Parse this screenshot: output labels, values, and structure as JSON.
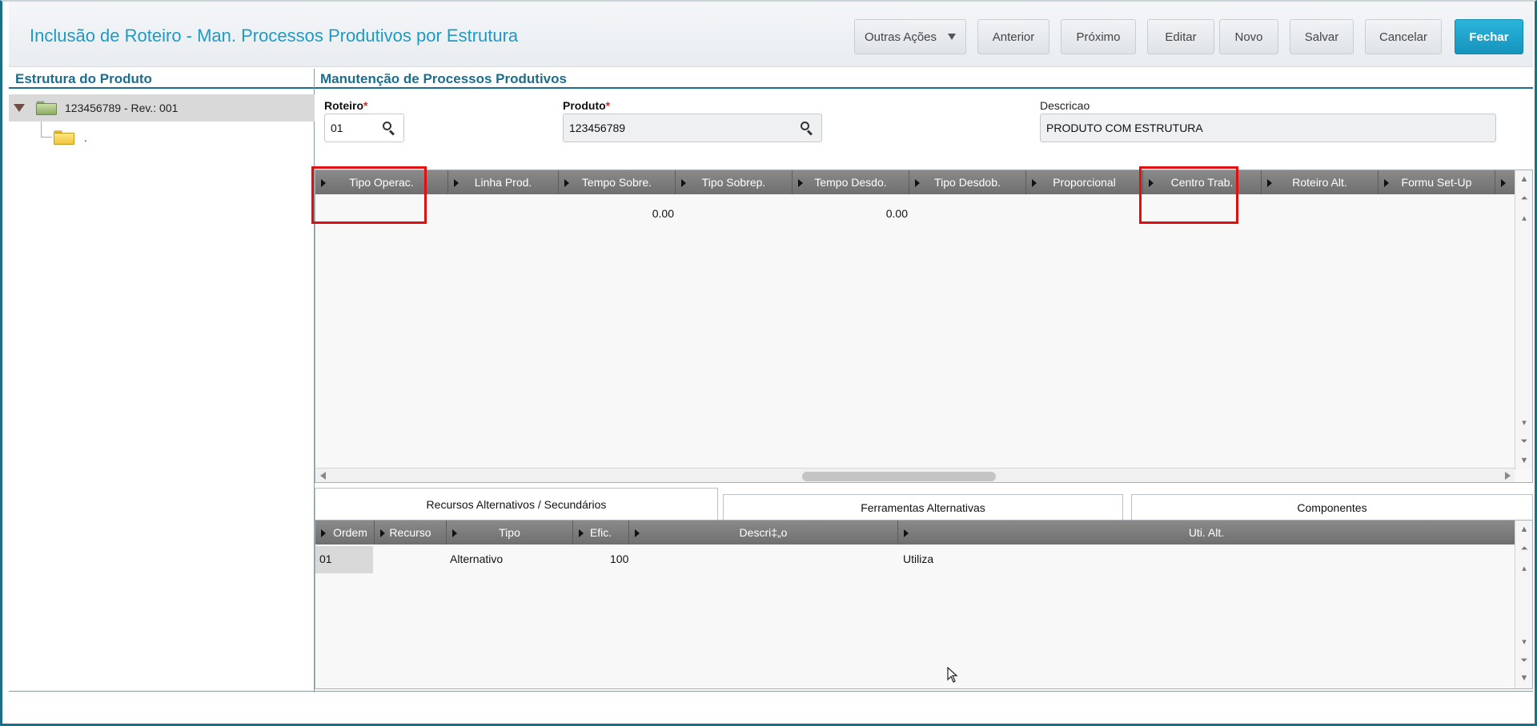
{
  "header": {
    "title": "Inclusão de Roteiro - Man. Processos Produtivos por Estrutura",
    "buttons": {
      "outras_acoes": "Outras Ações",
      "anterior": "Anterior",
      "proximo": "Próximo",
      "editar": "Editar",
      "novo": "Novo",
      "salvar": "Salvar",
      "cancelar": "Cancelar",
      "fechar": "Fechar"
    }
  },
  "left": {
    "title": "Estrutura do Produto",
    "tree": {
      "root_label": "123456789 - Rev.: 001",
      "child_label": "."
    }
  },
  "right": {
    "title": "Manutenção de Processos Produtivos",
    "roteiro": {
      "label": "Roteiro",
      "value": "01"
    },
    "produto": {
      "label": "Produto",
      "value": "123456789"
    },
    "descricao": {
      "label": "Descricao",
      "value": "PRODUTO COM ESTRUTURA"
    },
    "required_mark": "*"
  },
  "main_grid": {
    "columns": [
      "Tipo Operac.",
      "Linha Prod.",
      "Tempo Sobre.",
      "Tipo Sobrep.",
      "Tempo Desdo.",
      "Tipo Desdob.",
      "Proporcional",
      "Centro Trab.",
      "Roteiro Alt.",
      "Formu Set-Up"
    ],
    "row": {
      "tempo_sobre": "0.00",
      "tempo_desdo": "0.00"
    }
  },
  "tabs": {
    "recursos": "Recursos Alternativos / Secundários",
    "ferramentas": "Ferramentas Alternativas",
    "componentes": "Componentes"
  },
  "sub_grid": {
    "columns": [
      "Ordem",
      "Recurso",
      "Tipo",
      "Efic.",
      "Descri‡„o",
      "Uti. Alt."
    ],
    "rows": [
      {
        "ordem": "01",
        "recurso": "",
        "tipo": "Alternativo",
        "efic": "100",
        "descricao": "",
        "uti_alt": "Utiliza"
      }
    ]
  },
  "colors": {
    "accent": "#1f9ac4",
    "section_title": "#1c6d8e",
    "primary_button": "#1a9fc8",
    "highlight_box": "#e01010",
    "grid_header": "#7a7a7a"
  }
}
